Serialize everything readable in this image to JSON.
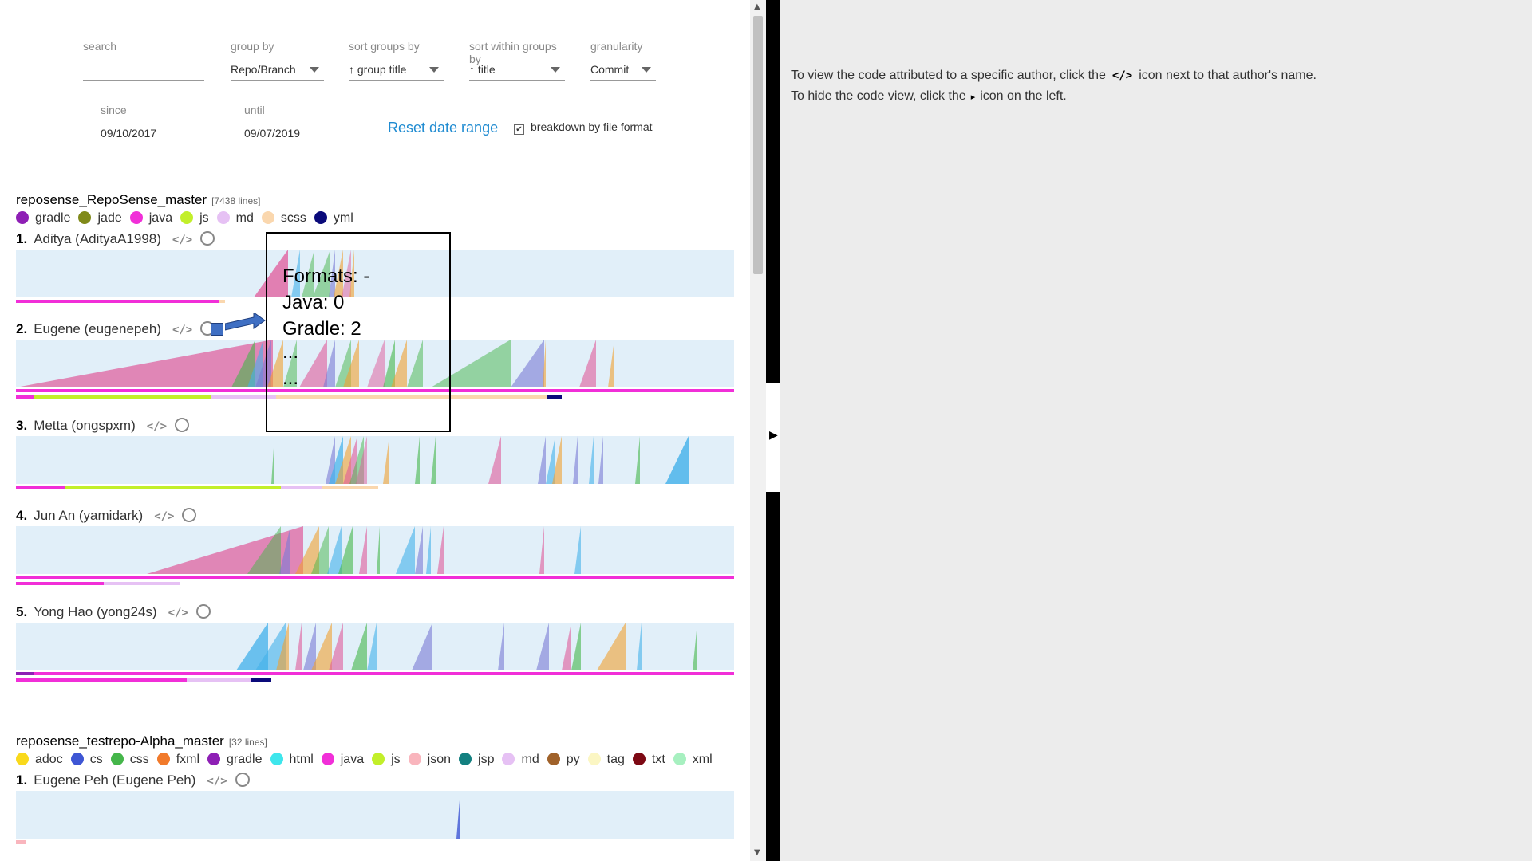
{
  "controls": {
    "search": {
      "label": "search",
      "placeholder": ""
    },
    "group_by": {
      "label": "group by",
      "value": "Repo/Branch"
    },
    "sort_groups_by": {
      "label": "sort groups by",
      "value": "↑ group title"
    },
    "sort_within_groups_by": {
      "label": "sort within groups by",
      "value": "↑ title"
    },
    "granularity": {
      "label": "granularity",
      "value": "Commit"
    },
    "since": {
      "label": "since",
      "value": "09/10/2017"
    },
    "until": {
      "label": "until",
      "value": "09/07/2019"
    },
    "reset_label": "Reset date range",
    "breakdown_label": "breakdown by file format",
    "breakdown_checked": true
  },
  "hint": {
    "line1_pre": "To view the code attributed to a specific author, click the",
    "line1_icon": "</>",
    "line1_post": "icon next to that author's name.",
    "line2_pre": "To hide the code view, click the",
    "line2_icon": "▸",
    "line2_post": "icon on the left."
  },
  "tooltip": {
    "lines": [
      "Formats: -",
      "Java: 0",
      "Gradle: 2",
      "...",
      "..."
    ]
  },
  "colors": {
    "gradle": "#8e1fb5",
    "jade": "#808a1a",
    "java": "#f12fd8",
    "js": "#c2ef2a",
    "md": "#e6c1f4",
    "scss": "#fad7ae",
    "yml": "#0a0a7a",
    "adoc": "#f9d91c",
    "cs": "#3e56d4",
    "css": "#45b64a",
    "fxml": "#f17a2b",
    "html": "#3ee6ec",
    "json": "#f9b5bd",
    "jsp": "#138080",
    "py": "#a0622a",
    "tag": "#fbf6c3",
    "txt": "#7d0914",
    "xml": "#a7f0c0"
  },
  "repos": [
    {
      "title": "reposense_RepoSense_master",
      "lines": "[7438 lines]",
      "legend": [
        "gradle",
        "jade",
        "java",
        "js",
        "md",
        "scss",
        "yml"
      ],
      "authors": [
        {
          "num": "1.",
          "name": "Aditya (AdityaA1998)"
        },
        {
          "num": "2.",
          "name": "Eugene (eugenepeh)"
        },
        {
          "num": "3.",
          "name": "Metta (ongspxm)"
        },
        {
          "num": "4.",
          "name": "Jun An (yamidark)"
        },
        {
          "num": "5.",
          "name": "Yong Hao (yong24s)"
        }
      ]
    },
    {
      "title": "reposense_testrepo-Alpha_master",
      "lines": "[32 lines]",
      "legend": [
        "adoc",
        "cs",
        "css",
        "fxml",
        "gradle",
        "html",
        "java",
        "js",
        "json",
        "jsp",
        "md",
        "py",
        "tag",
        "txt",
        "xml"
      ],
      "authors": [
        {
          "num": "1.",
          "name": "Eugene Peh (Eugene Peh)"
        }
      ]
    }
  ],
  "icons": {
    "code": "</>",
    "github": "github-icon"
  }
}
